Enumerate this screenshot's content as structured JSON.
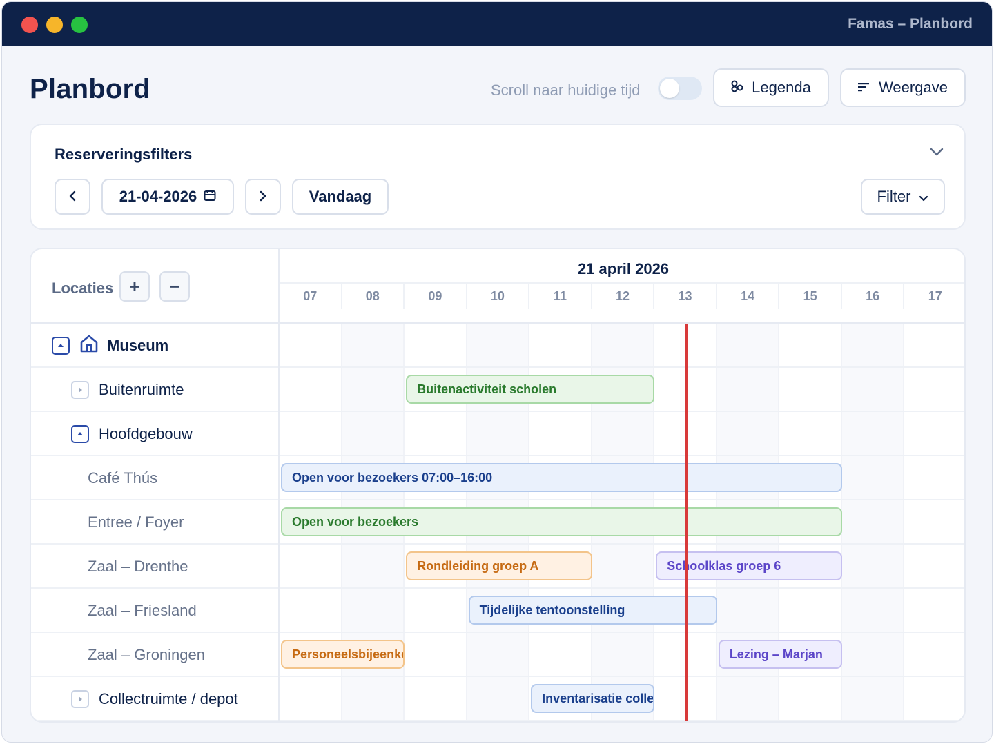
{
  "window": {
    "title": "Famas – Planbord"
  },
  "header": {
    "title": "Planbord",
    "scroll_label": "Scroll naar huidige tijd",
    "scroll_toggle_on": false,
    "legenda_label": "Legenda",
    "weergave_label": "Weergave"
  },
  "filters": {
    "title": "Reserveringsfilters",
    "date": "21-04-2026",
    "today_label": "Vandaag",
    "filter_label": "Filter"
  },
  "planner": {
    "locations_label": "Locaties",
    "date_label": "21 april 2026",
    "hours": [
      "07",
      "08",
      "09",
      "10",
      "11",
      "12",
      "13",
      "14",
      "15",
      "16",
      "17"
    ],
    "current_time_hour": 13.5,
    "rows": [
      {
        "label": "Museum",
        "level": 0,
        "expanded": true,
        "icon": "building-icon"
      },
      {
        "label": "Buitenruimte",
        "level": 1,
        "expanded": false
      },
      {
        "label": "Hoofdgebouw",
        "level": 1,
        "expanded": true
      },
      {
        "label": "Café Thús",
        "level": 2
      },
      {
        "label": "Entree / Foyer",
        "level": 2
      },
      {
        "label": "Zaal – Drenthe",
        "level": 2
      },
      {
        "label": "Zaal – Friesland",
        "level": 2
      },
      {
        "label": "Zaal – Groningen",
        "level": 2
      },
      {
        "label": "Collectruimte / depot",
        "level": 1,
        "expanded": false
      }
    ],
    "events": [
      {
        "row": 1,
        "start": 9,
        "end": 13,
        "label": "Buitenactiviteit scholen",
        "color": "green"
      },
      {
        "row": 3,
        "start": 7,
        "end": 16,
        "label": "Open voor bezoekers 07:00–16:00",
        "color": "blue"
      },
      {
        "row": 4,
        "start": 7,
        "end": 16,
        "label": "Open voor bezoekers",
        "color": "green"
      },
      {
        "row": 5,
        "start": 9,
        "end": 12,
        "label": "Rondleiding groep A",
        "color": "orange"
      },
      {
        "row": 5,
        "start": 13,
        "end": 16,
        "label": "Schoolklas groep 6",
        "color": "purple"
      },
      {
        "row": 6,
        "start": 10,
        "end": 14,
        "label": "Tijdelijke tentoonstelling",
        "color": "blue"
      },
      {
        "row": 7,
        "start": 7,
        "end": 9,
        "label": "Personeelsbijeenko",
        "color": "orange"
      },
      {
        "row": 7,
        "start": 14,
        "end": 16,
        "label": "Lezing – Marjan",
        "color": "purple"
      },
      {
        "row": 8,
        "start": 11,
        "end": 13,
        "label": "Inventarisatie colle",
        "color": "blue"
      }
    ]
  },
  "colors": {
    "navy": "#0e2249",
    "now_line": "#d83a3a",
    "green": "#2a7a2d",
    "blue": "#1a3f8c",
    "orange": "#c66a12",
    "purple": "#5b45c8"
  }
}
